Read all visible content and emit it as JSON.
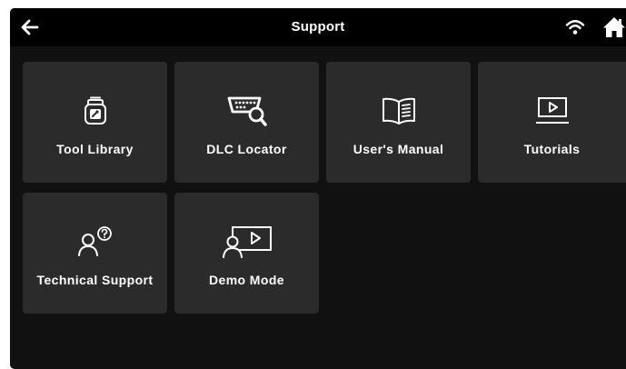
{
  "header": {
    "title": "Support",
    "back_icon": "arrow-left-icon",
    "wifi_icon": "wifi-icon",
    "home_icon": "home-icon"
  },
  "tiles": [
    {
      "label": "Tool Library",
      "icon": "tool-library-icon"
    },
    {
      "label": "DLC Locator",
      "icon": "dlc-locator-icon"
    },
    {
      "label": "User's Manual",
      "icon": "book-icon"
    },
    {
      "label": "Tutorials",
      "icon": "video-play-icon"
    },
    {
      "label": "Technical Support",
      "icon": "user-question-icon"
    },
    {
      "label": "Demo Mode",
      "icon": "user-presentation-icon"
    }
  ],
  "colors": {
    "background": "#111111",
    "header": "#000000",
    "tile": "#2b2b2b",
    "text": "#ffffff"
  }
}
